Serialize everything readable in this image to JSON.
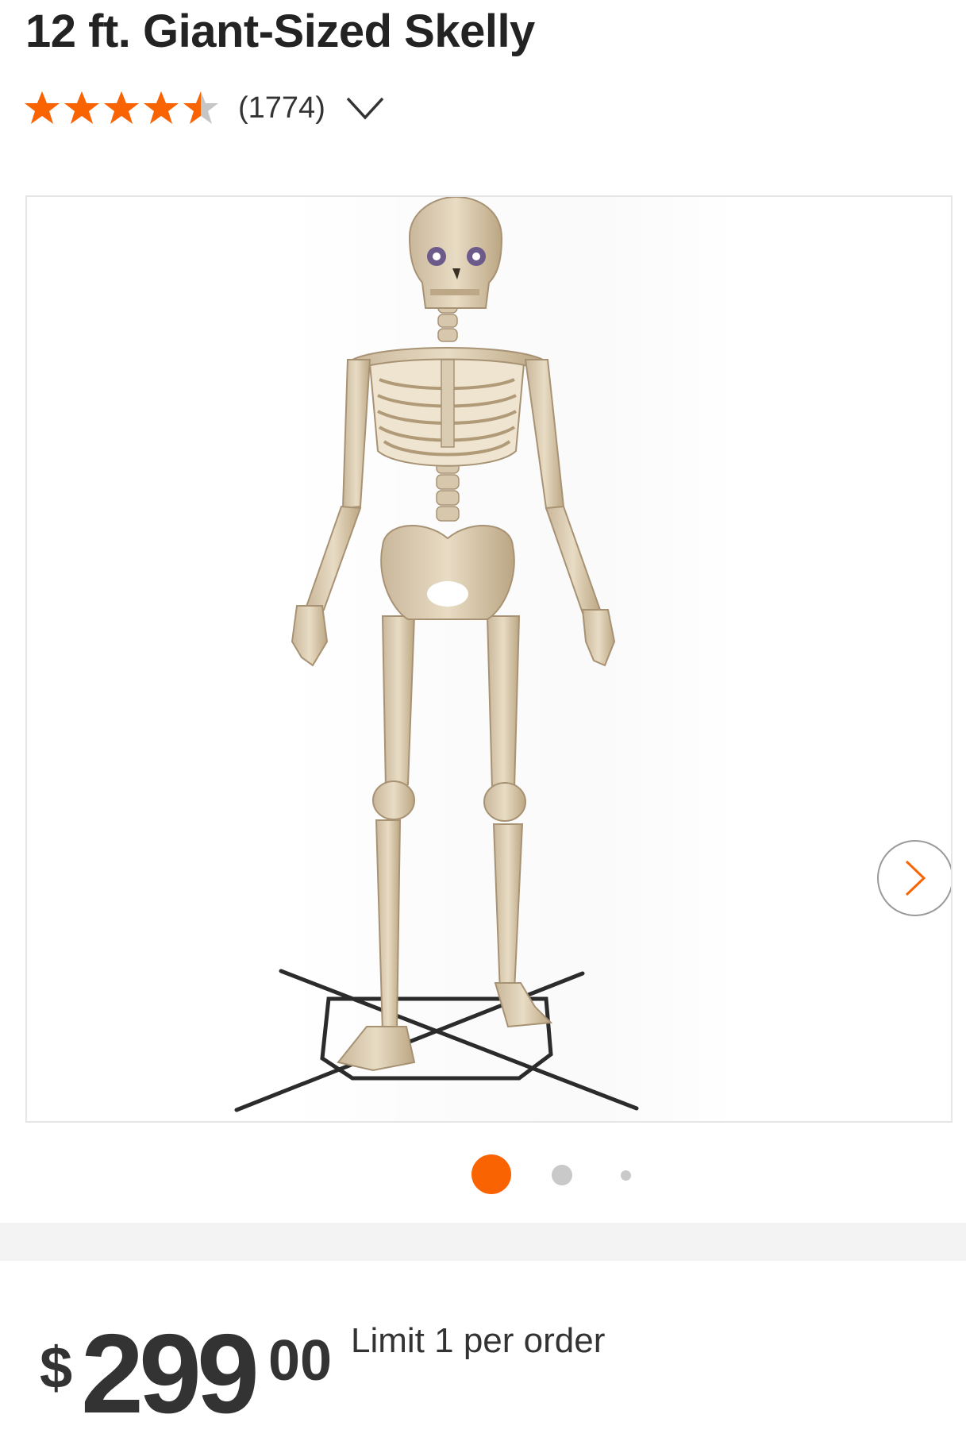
{
  "product": {
    "title": "12 ft. Giant-Sized Skelly",
    "rating": 4.5,
    "rating_max": 5,
    "review_count": "(1774)",
    "star_color": "#f96302"
  },
  "gallery": {
    "image_alt": "Giant skeleton decoration standing on metal stand",
    "next_icon": "chevron-right-icon",
    "active_slide": 1,
    "slide_count": 3
  },
  "pricing": {
    "currency_symbol": "$",
    "dollars": "299",
    "cents": "00",
    "limit_text": "Limit 1 per order"
  },
  "colors": {
    "accent": "#f96302",
    "dot_inactive": "#c9c9c9"
  }
}
